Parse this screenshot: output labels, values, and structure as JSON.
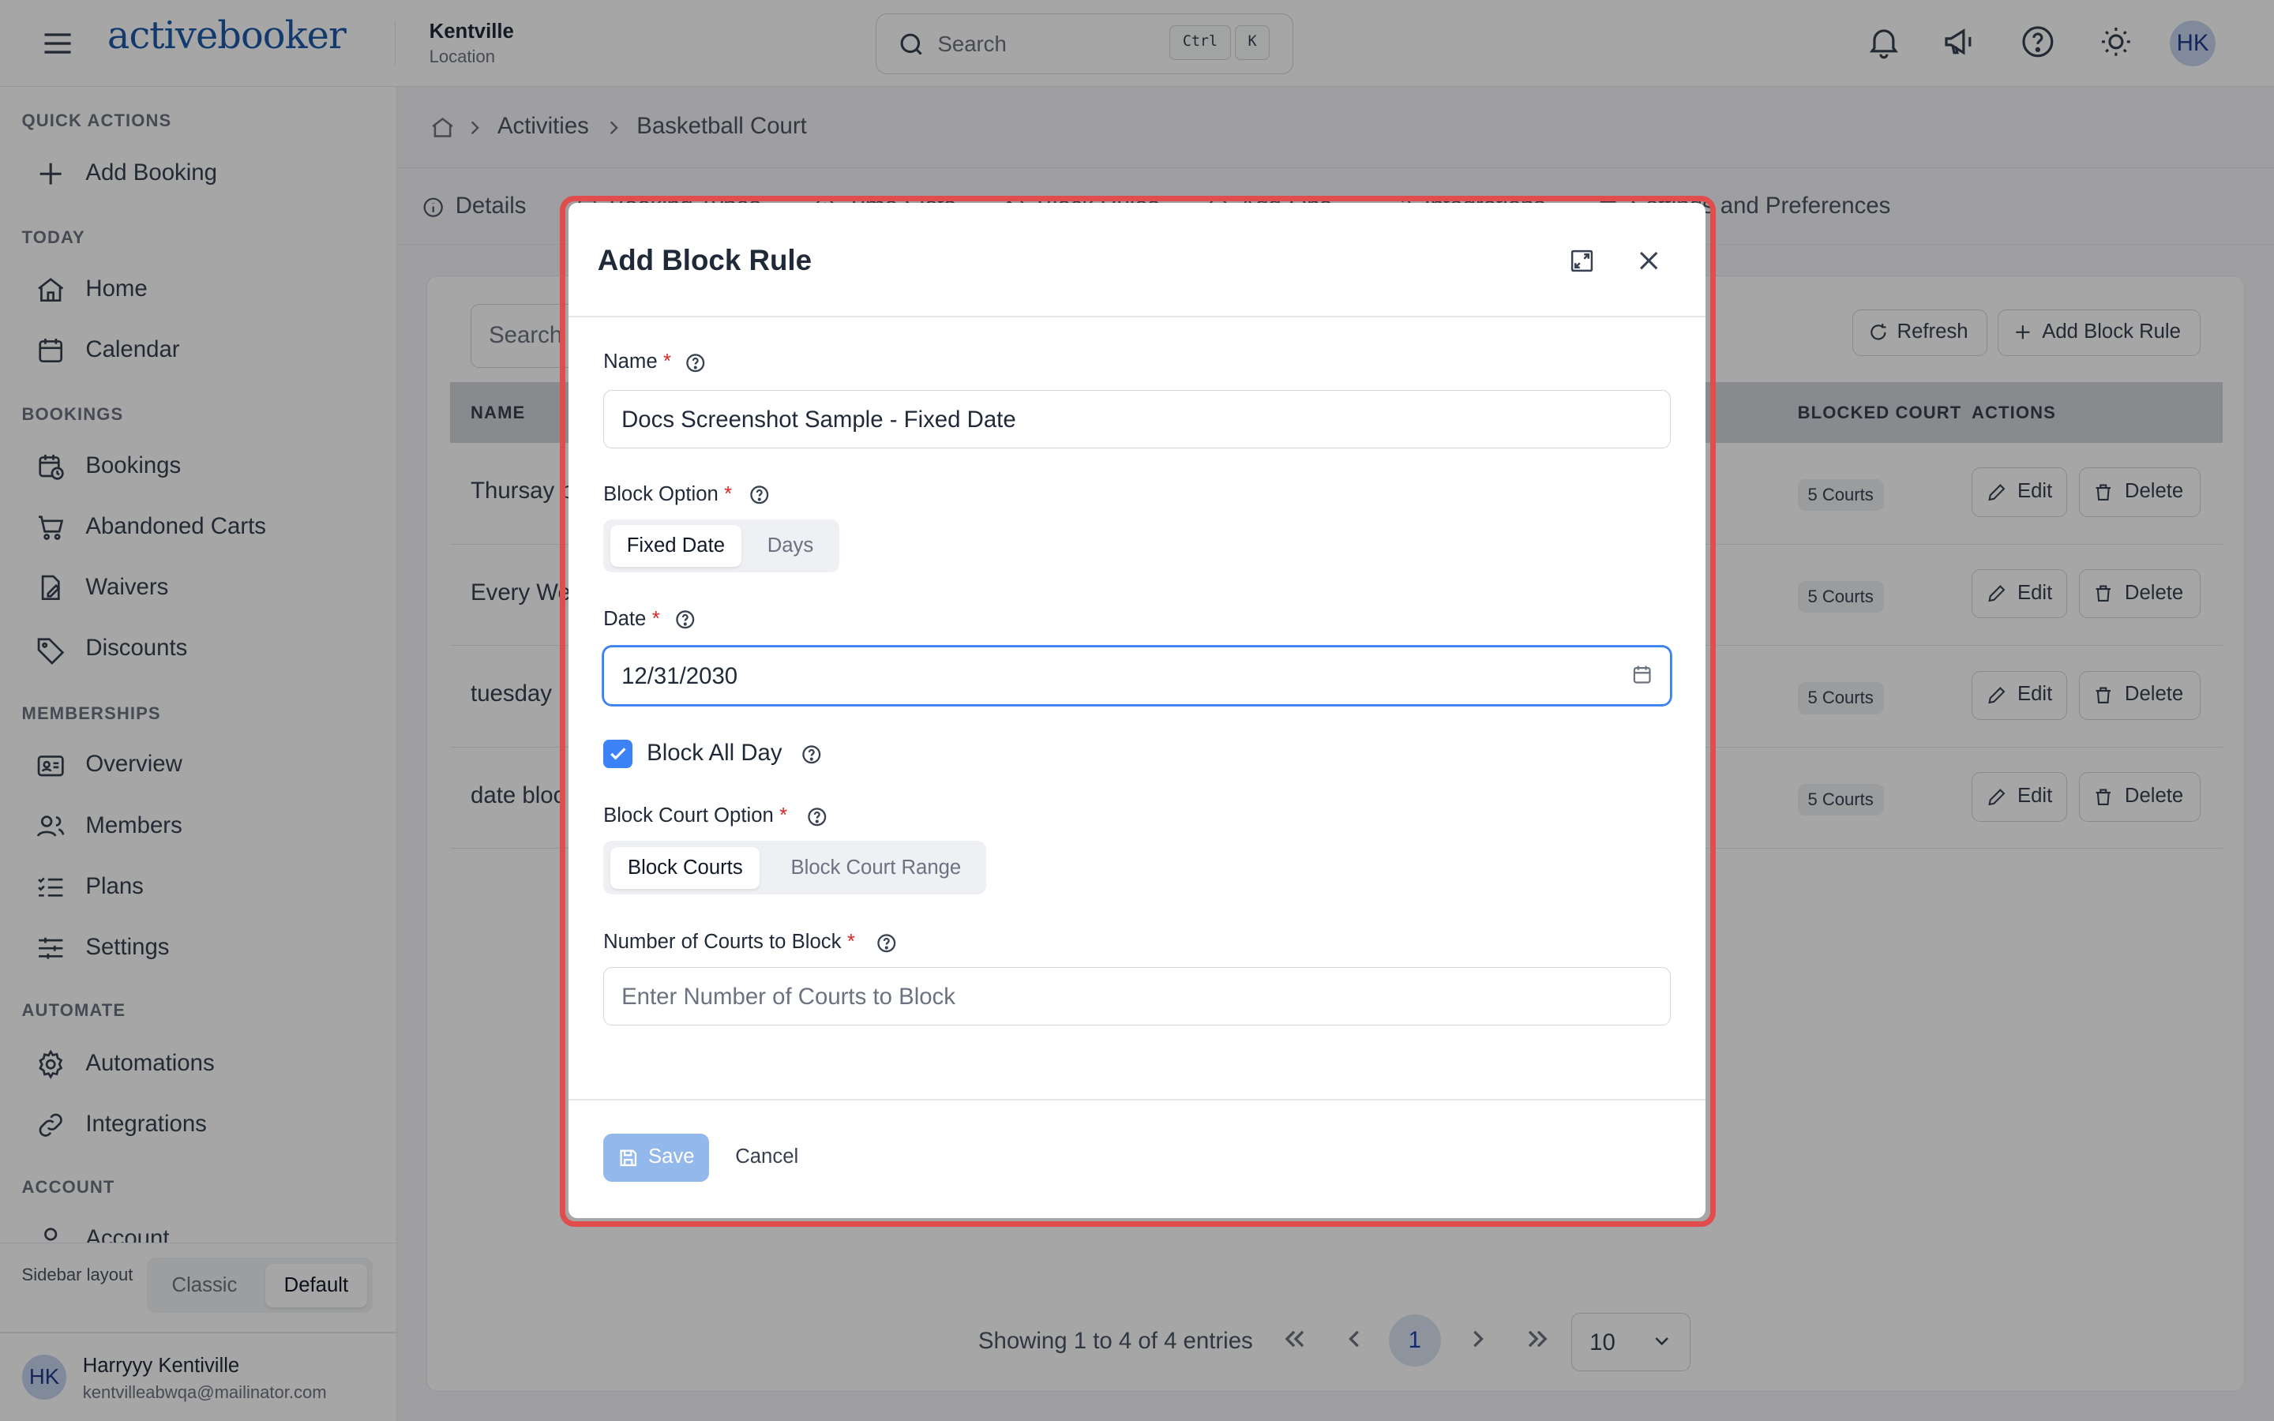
{
  "header": {
    "logo": "activebooker",
    "location_name": "Kentville",
    "location_sub": "Location",
    "search_placeholder": "Search",
    "kbd_ctrl": "Ctrl",
    "kbd_k": "K",
    "avatar": "HK"
  },
  "sidebar": {
    "sections": {
      "quick_actions": "QUICK ACTIONS",
      "today": "TODAY",
      "bookings": "BOOKINGS",
      "memberships": "MEMBERSHIPS",
      "automate": "AUTOMATE",
      "account": "ACCOUNT"
    },
    "items": {
      "add_booking": "Add Booking",
      "home": "Home",
      "calendar": "Calendar",
      "bookings": "Bookings",
      "abandoned_carts": "Abandoned Carts",
      "waivers": "Waivers",
      "discounts": "Discounts",
      "overview": "Overview",
      "members": "Members",
      "plans": "Plans",
      "settings": "Settings",
      "automations": "Automations",
      "integrations": "Integrations",
      "account": "Account"
    },
    "layout_label": "Sidebar layout",
    "layout_options": [
      "Classic",
      "Default"
    ],
    "user": {
      "initials": "HK",
      "name": "Harryyy Kentiville",
      "email": "kentvilleabwqa@mailinator.com"
    }
  },
  "breadcrumb": [
    "Activities",
    "Basketball Court"
  ],
  "tabs": [
    "Details",
    "Booking Types",
    "Time Slots",
    "Block Rules",
    "Add-Ons",
    "Integrations",
    "Settings and Preferences"
  ],
  "table": {
    "search_placeholder": "Search",
    "refresh_label": "Refresh",
    "add_label": "Add Block Rule",
    "headers": {
      "name": "NAME",
      "blocked_court": "BLOCKED COURT",
      "actions": "ACTIONS"
    },
    "rows": [
      {
        "name": "Thursay b",
        "courts": "5 Courts"
      },
      {
        "name": "Every We",
        "courts": "5 Courts"
      },
      {
        "name": "tuesday",
        "courts": "5 Courts"
      },
      {
        "name": "date bloc",
        "courts": "5 Courts"
      }
    ],
    "edit_label": "Edit",
    "delete_label": "Delete",
    "pager_text": "Showing 1 to 4 of 4 entries",
    "current_page": "1",
    "page_size": "10"
  },
  "modal": {
    "title": "Add Block Rule",
    "name_label": "Name",
    "name_value": "Docs Screenshot Sample - Fixed Date",
    "block_option_label": "Block Option",
    "block_options": [
      "Fixed Date",
      "Days"
    ],
    "date_label": "Date",
    "date_value": "12/31/2030",
    "block_all_day_label": "Block All Day",
    "block_all_day_checked": true,
    "court_option_label": "Block Court Option",
    "court_options": [
      "Block Courts",
      "Block Court Range"
    ],
    "num_courts_label": "Number of Courts to Block",
    "num_courts_placeholder": "Enter Number of Courts to Block",
    "save_label": "Save",
    "cancel_label": "Cancel",
    "required_mark": "*"
  },
  "colors": {
    "primary": "#3b82f6",
    "highlight": "#e14d4d",
    "save_disabled": "#93b8ec"
  }
}
